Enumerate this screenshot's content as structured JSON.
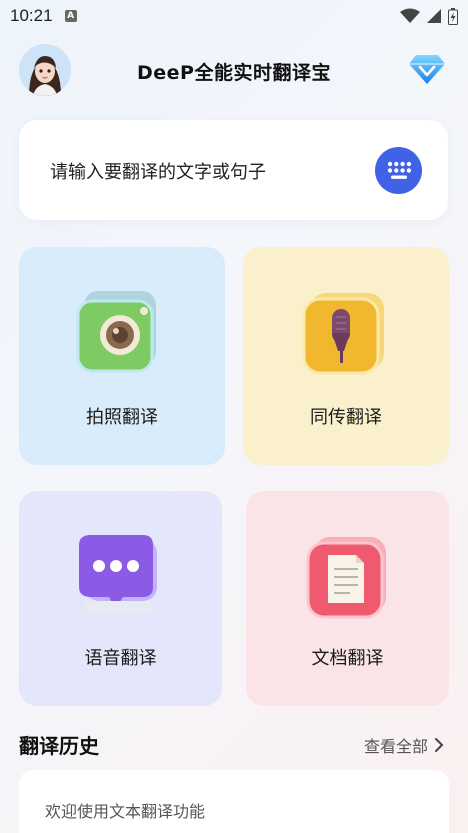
{
  "status_bar": {
    "time": "10:21",
    "notification_icon": "A"
  },
  "header": {
    "title": "DeeP全能实时翻译宝"
  },
  "input": {
    "placeholder": "请输入要翻译的文字或句子"
  },
  "features": [
    {
      "label": "拍照翻译",
      "icon": "camera-icon"
    },
    {
      "label": "同传翻译",
      "icon": "microphone-icon"
    },
    {
      "label": "语音翻译",
      "icon": "chat-bubble-icon"
    },
    {
      "label": "文档翻译",
      "icon": "document-icon"
    }
  ],
  "history": {
    "title": "翻译历史",
    "view_all": "查看全部",
    "items": [
      "欢迎使用文本翻译功能"
    ]
  },
  "colors": {
    "accent": "#3f62e6",
    "photo_card": "#d9ecfb",
    "simul_card": "#fbf0cc",
    "voice_card": "#e4e6fb",
    "doc_card": "#fbe4e7"
  }
}
